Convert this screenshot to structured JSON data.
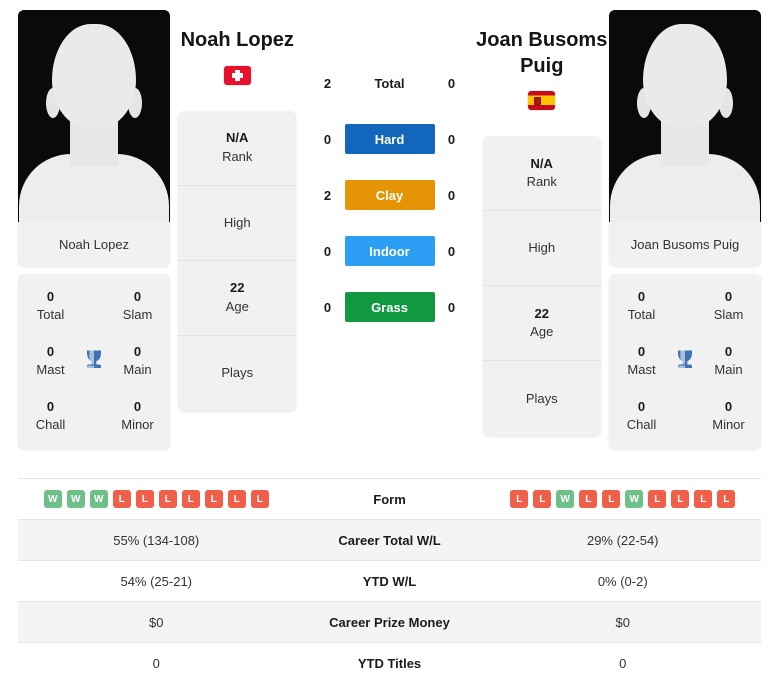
{
  "players": {
    "left": {
      "name": "Noah Lopez",
      "photo_caption": "Noah Lopez",
      "flag": "ch-flag-icon",
      "titles": {
        "total_value": "0",
        "total_label": "Total",
        "slam_value": "0",
        "slam_label": "Slam",
        "mast_value": "0",
        "mast_label": "Mast",
        "main_value": "0",
        "main_label": "Main",
        "chall_value": "0",
        "chall_label": "Chall",
        "minor_value": "0",
        "minor_label": "Minor"
      },
      "info": {
        "rank_value": "N/A",
        "rank_label": "Rank",
        "high_label": "High",
        "high_value": "",
        "age_value": "22",
        "age_label": "Age",
        "plays_label": "Plays",
        "plays_value": ""
      },
      "form": [
        "W",
        "W",
        "W",
        "L",
        "L",
        "L",
        "L",
        "L",
        "L",
        "L"
      ],
      "career_total_wl": "55% (134-108)",
      "ytd_wl": "54% (25-21)",
      "career_prize_money": "$0",
      "ytd_titles": "0"
    },
    "right": {
      "name": "Joan Busoms Puig",
      "photo_caption": "Joan Busoms Puig",
      "flag": "es-flag-icon",
      "titles": {
        "total_value": "0",
        "total_label": "Total",
        "slam_value": "0",
        "slam_label": "Slam",
        "mast_value": "0",
        "mast_label": "Mast",
        "main_value": "0",
        "main_label": "Main",
        "chall_value": "0",
        "chall_label": "Chall",
        "minor_value": "0",
        "minor_label": "Minor"
      },
      "info": {
        "rank_value": "N/A",
        "rank_label": "Rank",
        "high_label": "High",
        "high_value": "",
        "age_value": "22",
        "age_label": "Age",
        "plays_label": "Plays",
        "plays_value": ""
      },
      "form": [
        "L",
        "L",
        "W",
        "L",
        "L",
        "W",
        "L",
        "L",
        "L",
        "L"
      ],
      "career_total_wl": "29% (22-54)",
      "ytd_wl": "0% (0-2)",
      "career_prize_money": "$0",
      "ytd_titles": "0"
    }
  },
  "surfaces": [
    {
      "label": "Total",
      "left": "2",
      "right": "0",
      "color": "transparent",
      "plain": true
    },
    {
      "label": "Hard",
      "left": "0",
      "right": "0",
      "color": "#1266bb",
      "plain": false
    },
    {
      "label": "Clay",
      "left": "2",
      "right": "0",
      "color": "#e59405",
      "plain": false
    },
    {
      "label": "Indoor",
      "left": "0",
      "right": "0",
      "color": "#2c9ef4",
      "plain": false
    },
    {
      "label": "Grass",
      "left": "0",
      "right": "0",
      "color": "#119942",
      "plain": false
    }
  ],
  "table": {
    "rows": [
      {
        "label": "Form",
        "type": "form"
      },
      {
        "label": "Career Total W/L",
        "type": "text",
        "key": "career_total_wl"
      },
      {
        "label": "YTD W/L",
        "type": "text",
        "key": "ytd_wl"
      },
      {
        "label": "Career Prize Money",
        "type": "text",
        "key": "career_prize_money"
      },
      {
        "label": "YTD Titles",
        "type": "text",
        "key": "ytd_titles"
      }
    ]
  },
  "colors": {
    "win_badge": "#6ec089",
    "loss_badge": "#ef5f4a",
    "card_bg": "#f1f1f1",
    "row_alt_bg": "#f4f4f4",
    "trophy": "#3f72b4"
  }
}
